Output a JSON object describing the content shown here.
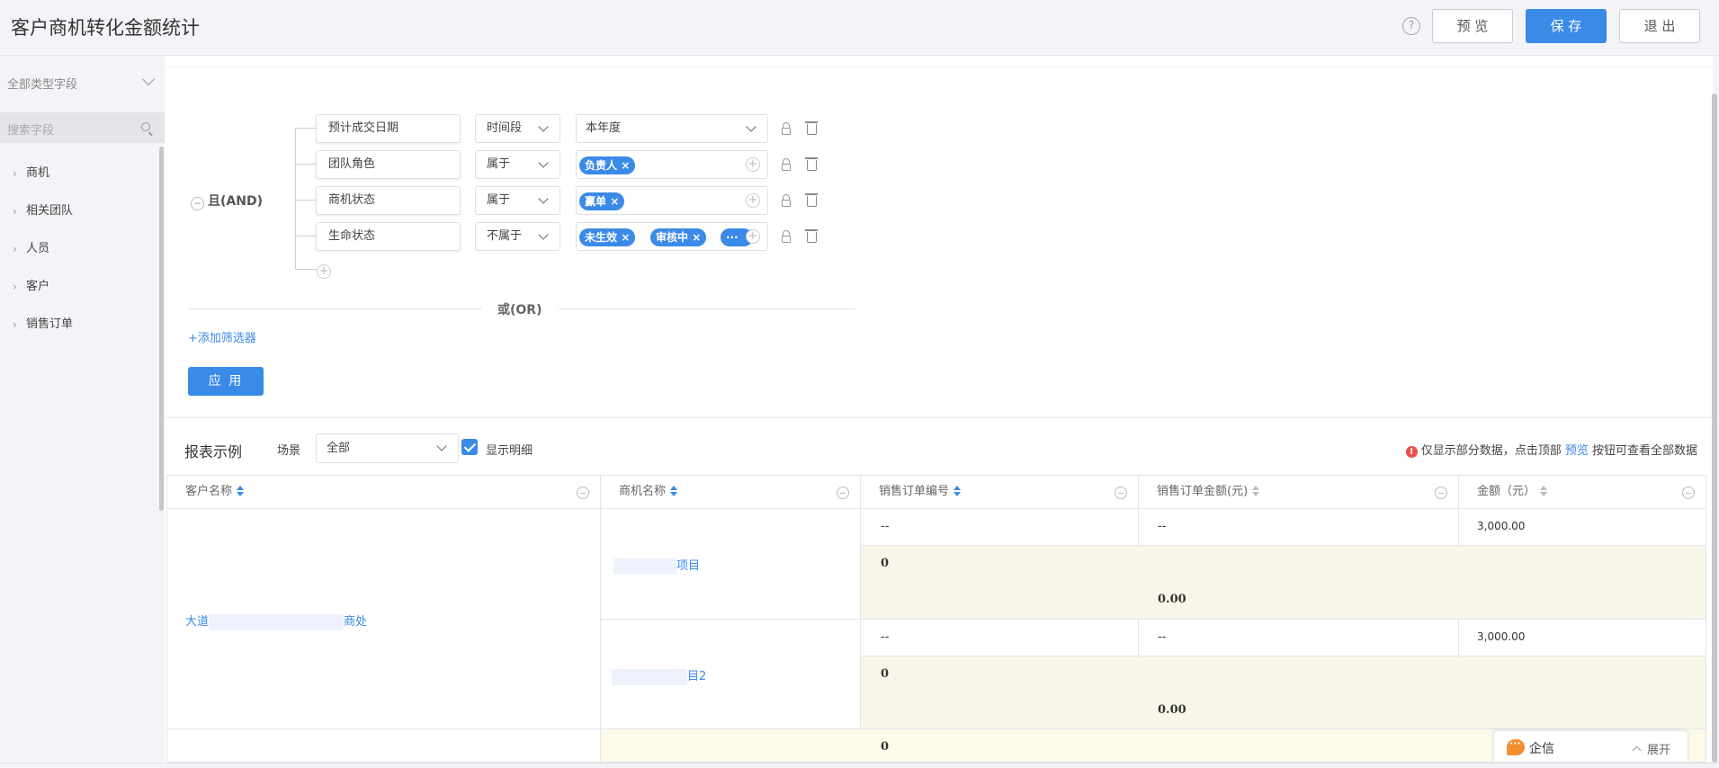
{
  "header": {
    "title": "客户商机转化金额统计",
    "help_icon": "?",
    "preview_label": "预 览",
    "save_label": "保 存",
    "exit_label": "退 出"
  },
  "sidebar": {
    "field_type_select": "全部类型字段",
    "search_placeholder": "搜索字段",
    "items": [
      {
        "label": "商机"
      },
      {
        "label": "相关团队"
      },
      {
        "label": "人员"
      },
      {
        "label": "客户"
      },
      {
        "label": "销售订单"
      }
    ]
  },
  "filters": {
    "logic_label": "且(AND)",
    "conditions": [
      {
        "field": "预计成交日期",
        "operator": "时间段",
        "value": "本年度",
        "tags": []
      },
      {
        "field": "团队角色",
        "operator": "属于",
        "value": "",
        "tags": [
          "负责人"
        ]
      },
      {
        "field": "商机状态",
        "operator": "属于",
        "value": "",
        "tags": [
          "赢单"
        ]
      },
      {
        "field": "生命状态",
        "operator": "不属于",
        "value": "",
        "tags": [
          "未生效",
          "审核中",
          "···"
        ]
      }
    ],
    "or_label": "或(OR)",
    "add_filter_label": "+添加筛选器",
    "apply_label": "应 用"
  },
  "report": {
    "title": "报表示例",
    "scene_label": "场景",
    "scene_value": "全部",
    "show_detail_label": "显示明细",
    "show_detail_checked": true,
    "notice_prefix": "仅显示部分数据，点击顶部 ",
    "notice_link": "预览",
    "notice_suffix": " 按钮可查看全部数据",
    "columns": [
      "客户名称",
      "商机名称",
      "销售订单编号",
      "销售订单金额(元)",
      "金额（元）"
    ],
    "customer_visible": [
      "大道",
      "商处"
    ],
    "rows": [
      {
        "opportunity_visible": "项目",
        "order_no": "--",
        "order_amount": "--",
        "amount": "3,000.00",
        "subtotal_count": "0",
        "subtotal_amount": "0.00"
      },
      {
        "opportunity_visible": "目2",
        "order_no": "--",
        "order_amount": "--",
        "amount": "3,000.00",
        "subtotal_count": "0",
        "subtotal_amount": "0.00"
      }
    ],
    "total_count": "0"
  },
  "chat_widget": {
    "name": "企信",
    "expand_label": "展开"
  },
  "colors": {
    "accent": "#3a8ae8",
    "subtotal_bg": "#f7f6e9",
    "chat_orange": "#f18f2e"
  }
}
